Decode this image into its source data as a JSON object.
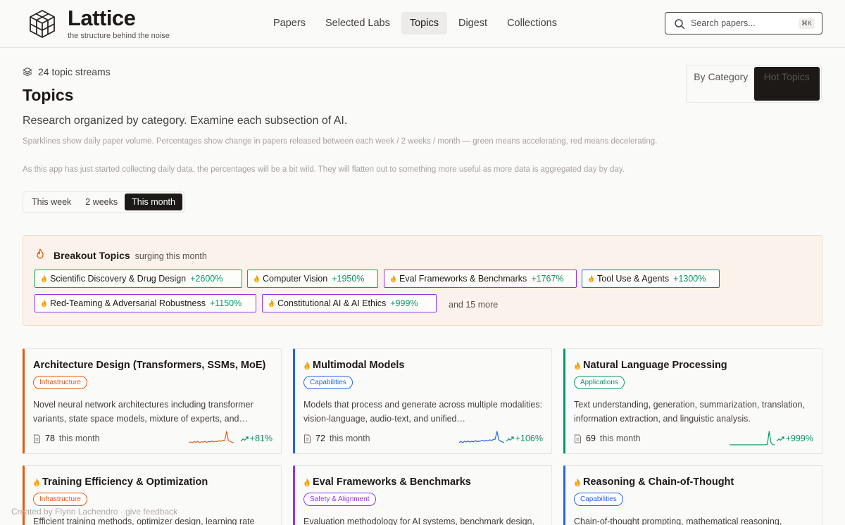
{
  "brand": {
    "name": "Lattice",
    "tagline": "the structure behind the noise"
  },
  "nav": [
    {
      "label": "Papers"
    },
    {
      "label": "Selected Labs"
    },
    {
      "label": "Topics"
    },
    {
      "label": "Digest"
    },
    {
      "label": "Collections"
    }
  ],
  "search": {
    "placeholder": "Search papers...",
    "shortcut": "⌘K"
  },
  "page": {
    "stream_count": "24 topic streams",
    "title": "Topics",
    "subtitle": "Research organized by category. Examine each subsection of AI.",
    "note1": "Sparklines show daily paper volume. Percentages show change in papers released between each week / 2 weeks / month — green means accelerating, red means decelerating.",
    "note2": "As this app has just started collecting daily data, the percentages will be a bit wild. They will flatten out to something more useful as more data is aggregated day by day."
  },
  "range_toggle": [
    "This week",
    "2 weeks",
    "This month"
  ],
  "view_toggle": [
    "By Category",
    "Hot Topics"
  ],
  "breakout": {
    "title": "Breakout Topics",
    "subtitle": "surging this month",
    "chips": [
      {
        "label": "Scientific Discovery & Drug Design",
        "pct": "+2600%",
        "color": "#16a34a"
      },
      {
        "label": "Computer Vision",
        "pct": "+1950%",
        "color": "#16a34a"
      },
      {
        "label": "Eval Frameworks & Benchmarks",
        "pct": "+1767%",
        "color": "#9333ea"
      },
      {
        "label": "Tool Use & Agents",
        "pct": "+1300%",
        "color": "#2563eb"
      },
      {
        "label": "Red-Teaming & Adversarial Robustness",
        "pct": "+1150%",
        "color": "#9333ea"
      },
      {
        "label": "Constitutional AI & AI Ethics",
        "pct": "+999%",
        "color": "#9333ea"
      }
    ],
    "more": "and 15 more"
  },
  "cards": [
    {
      "title": "Architecture Design (Transformers, SSMs, MoE)",
      "hot": false,
      "badge": "Infrastructure",
      "color": "#ea580c",
      "desc": "Novel neural network architectures including transformer variants, state space models, mixture of experts, and…",
      "count": "78",
      "count_label": "this month",
      "trend": "+81%"
    },
    {
      "title": "Multimodal Models",
      "hot": true,
      "badge": "Capabilities",
      "color": "#2563eb",
      "desc": "Models that process and generate across multiple modalities: vision-language, audio-text, and unified…",
      "count": "72",
      "count_label": "this month",
      "trend": "+106%"
    },
    {
      "title": "Natural Language Processing",
      "hot": true,
      "badge": "Applications",
      "color": "#059669",
      "desc": "Text understanding, generation, summarization, translation, information extraction, and linguistic analysis.",
      "count": "69",
      "count_label": "this month",
      "trend": "+999%"
    },
    {
      "title": "Training Efficiency & Optimization",
      "hot": true,
      "badge": "Infrastructure",
      "color": "#ea580c",
      "desc": "Efficient training methods, optimizer design, learning rate",
      "count": "",
      "count_label": "",
      "trend": ""
    },
    {
      "title": "Eval Frameworks & Benchmarks",
      "hot": true,
      "badge": "Safety & Alignment",
      "color": "#9333ea",
      "desc": "Evaluation methodology for AI systems, benchmark design,",
      "count": "",
      "count_label": "",
      "trend": ""
    },
    {
      "title": "Reasoning & Chain-of-Thought",
      "hot": true,
      "badge": "Capabilities",
      "color": "#2563eb",
      "desc": "Chain-of-thought prompting, mathematical reasoning,",
      "count": "",
      "count_label": "",
      "trend": ""
    }
  ],
  "footer": "Created by Flynn Lachendro · give feedback"
}
